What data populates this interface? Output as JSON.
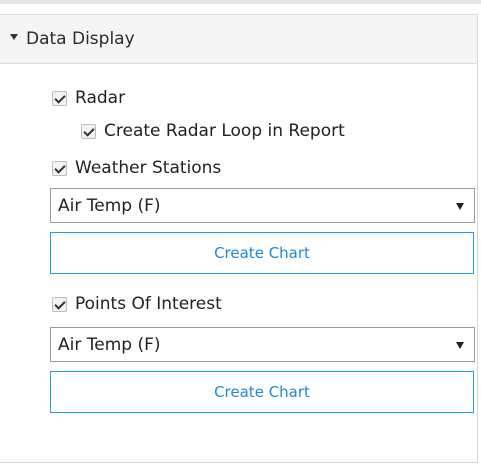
{
  "panel": {
    "title": "Data Display",
    "items": {
      "radar": {
        "label": "Radar",
        "checked": true
      },
      "radar_loop": {
        "label": "Create Radar Loop in Report",
        "checked": true
      },
      "weather_stations": {
        "label": "Weather Stations",
        "checked": true
      },
      "weather_stations_select": {
        "value": "Air Temp (F)"
      },
      "weather_stations_button": {
        "label": "Create Chart"
      },
      "points_of_interest": {
        "label": "Points Of Interest",
        "checked": true
      },
      "points_of_interest_select": {
        "value": "Air Temp (F)"
      },
      "points_of_interest_button": {
        "label": "Create Chart"
      }
    }
  },
  "icons": {
    "header_toggle": "caret-down-icon",
    "select_arrow": "dropdown-arrow-icon",
    "checkbox_mark": "checkmark-icon"
  },
  "colors": {
    "accent": "#1e9fe8",
    "accent_text": "#1e88d8",
    "header_bg": "#f5f5f5"
  }
}
